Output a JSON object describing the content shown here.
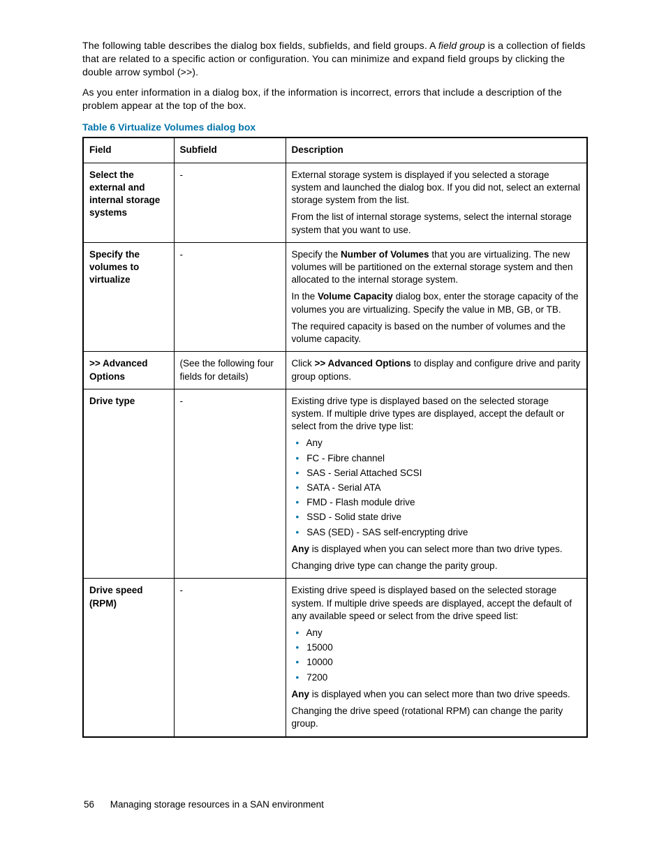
{
  "intro": {
    "p1a": "The following table describes the dialog box fields, subfields, and field groups. A ",
    "p1b": "field group",
    "p1c": " is a collection of fields that are related to a specific action or configuration. You can minimize and expand field groups by clicking the double arrow symbol (>>).",
    "p2": "As you enter information in a dialog box, if the information is incorrect, errors that include a description of the problem appear at the top of the box."
  },
  "tableCaption": "Table 6 Virtualize Volumes dialog box",
  "headers": {
    "field": "Field",
    "subfield": "Subfield",
    "description": "Description"
  },
  "rows": [
    {
      "field": "Select the external and internal storage systems",
      "subfield": "-",
      "desc": {
        "p": [
          "External storage system is displayed if you selected a storage system and launched the dialog box. If you did not, select an external storage system from the list.",
          "From the list of internal storage systems, select the internal storage system that you want to use."
        ]
      }
    },
    {
      "field": "Specify the volumes to virtualize",
      "subfield": "-",
      "desc": {
        "rich": [
          {
            "t": "Specify the "
          },
          {
            "b": "Number of Volumes"
          },
          {
            "t": " that you are virtualizing. The new volumes will be partitioned on the external storage system and then allocated to the internal storage system."
          }
        ],
        "rich2": [
          {
            "t": "In the "
          },
          {
            "b": "Volume Capacity"
          },
          {
            "t": " dialog box, enter the storage capacity of the volumes you are virtualizing. Specify the value in MB, GB, or TB."
          }
        ],
        "p3": "The required capacity is based on the number of volumes and the volume capacity."
      }
    },
    {
      "field": ">> Advanced Options",
      "subfield": "(See the following four fields for details)",
      "desc": {
        "rich": [
          {
            "t": "Click "
          },
          {
            "b": ">> Advanced Options"
          },
          {
            "t": " to display and configure drive and parity group options."
          }
        ]
      }
    },
    {
      "field": "Drive type",
      "subfield": "-",
      "desc": {
        "intro": "Existing drive type is displayed based on the selected storage system. If multiple drive types are displayed, accept the default or select from the drive type list:",
        "items": [
          "Any",
          "FC - Fibre channel",
          "SAS - Serial Attached SCSI",
          "SATA - Serial ATA",
          "FMD - Flash module drive",
          "SSD - Solid state drive",
          "SAS (SED) - SAS self-encrypting drive"
        ],
        "after1": [
          {
            "b": "Any"
          },
          {
            "t": " is displayed when you can select more than two drive types."
          }
        ],
        "after2": "Changing drive type can change the parity group."
      }
    },
    {
      "field": "Drive speed (RPM)",
      "subfield": "-",
      "desc": {
        "intro": "Existing drive speed is displayed based on the selected storage system. If multiple drive speeds are displayed, accept the default of any available speed or select from the drive speed list:",
        "items": [
          "Any",
          "15000",
          "10000",
          "7200"
        ],
        "after1": [
          {
            "b": "Any"
          },
          {
            "t": " is displayed when you can select more than two drive speeds."
          }
        ],
        "after2": "Changing the drive speed (rotational RPM) can change the parity group."
      }
    }
  ],
  "footer": {
    "pageNum": "56",
    "section": "Managing storage resources in a SAN environment"
  }
}
